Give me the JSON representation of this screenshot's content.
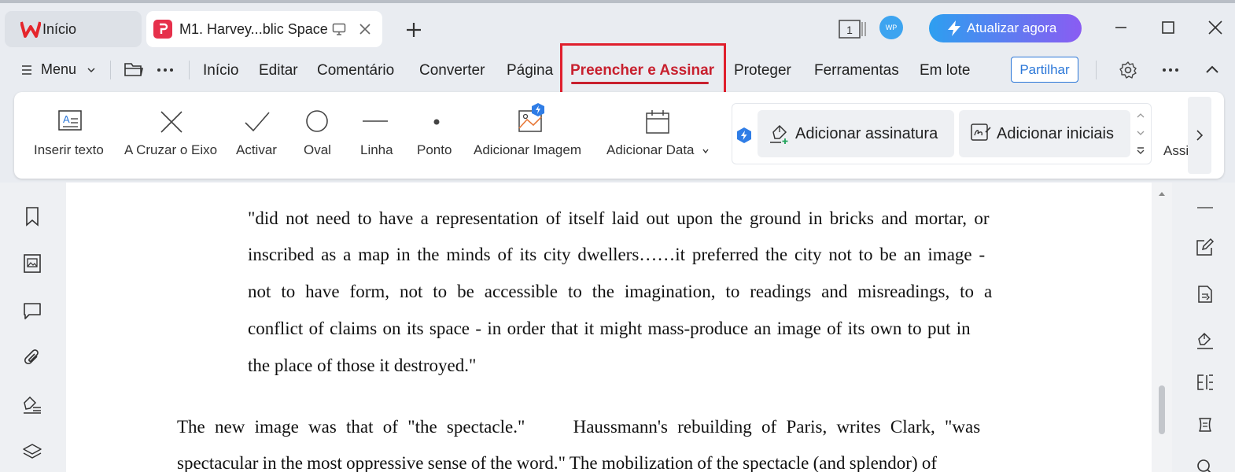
{
  "tabs": {
    "home_label": "Início",
    "doc_label": "M1. Harvey...blic Space"
  },
  "topbar": {
    "page_count": "1",
    "avatar_initials": "WP",
    "upgrade_label": "Atualizar agora"
  },
  "menubar": {
    "menu_label": "Menu",
    "items": [
      "Início",
      "Editar",
      "Comentário",
      "Converter",
      "Página",
      "Preencher e Assinar",
      "Proteger",
      "Ferramentas",
      "Em lote"
    ],
    "share_label": "Partilhar"
  },
  "ribbon": {
    "tools": [
      "Inserir texto",
      "A Cruzar o Eixo",
      "Activar",
      "Oval",
      "Linha",
      "Ponto",
      "Adicionar Imagem",
      "Adicionar Data"
    ],
    "add_signature": "Adicionar assinatura",
    "add_initials": "Adicionar iniciais",
    "cut_label": "Assi"
  },
  "document": {
    "lines": [
      "\"did not need to have a representation of itself laid out upon the ground in bricks and mortar, or",
      "inscribed as a map in the minds of its city dwellers……it preferred the city not to be an image -",
      "not to have form, not to be accessible to the imagination, to readings and misreadings, to a",
      "conflict of claims on its space - in order that it might mass-produce an image of its own to put in",
      "the place of those it destroyed.\"",
      "The new image was that of \"the spectacle.\"     Haussmann's rebuilding of Paris, writes Clark, \"was",
      "spectacular in the most oppressive sense of the word.\" The mobilization of the spectacle (and splendor) of"
    ]
  },
  "colors": {
    "accent": "#c8202e",
    "highlight_box": "#e01f2d",
    "share_blue": "#2b77d8"
  }
}
